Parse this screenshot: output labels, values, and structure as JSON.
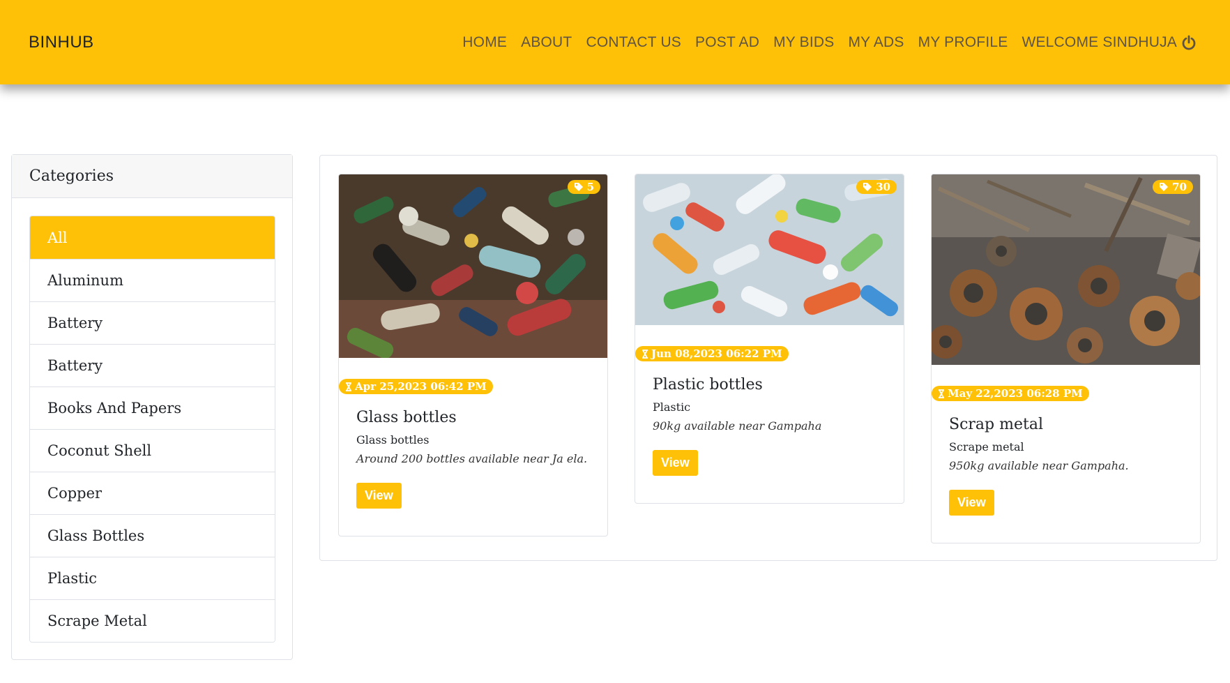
{
  "navbar": {
    "brand": "BINHUB",
    "links": [
      "HOME",
      "ABOUT",
      "CONTACT US",
      "POST AD",
      "MY BIDS",
      "MY ADS",
      "MY PROFILE"
    ],
    "welcome": "WELCOME SINDHUJA",
    "logout_icon": "power-icon"
  },
  "categories": {
    "header": "Categories",
    "items": [
      "All",
      "Aluminum",
      "Battery",
      "Battery",
      "Books And Papers",
      "Coconut Shell",
      "Copper",
      "Glass Bottles",
      "Plastic",
      "Scrape Metal"
    ],
    "active_index": 0
  },
  "listings": [
    {
      "tag_count": "5",
      "date": "Apr 25,2023 06:42 PM",
      "title": "Glass bottles",
      "category": "Glass bottles",
      "description": "Around 200 bottles available near Ja ela.",
      "button": "View",
      "image": "glass-bottles-photo"
    },
    {
      "tag_count": "30",
      "date": "Jun 08,2023 06:22 PM",
      "title": "Plastic bottles",
      "category": "Plastic",
      "description": "90kg available near Gampaha",
      "button": "View",
      "image": "plastic-bottles-photo"
    },
    {
      "tag_count": "70",
      "date": "May 22,2023 06:28 PM",
      "title": "Scrap metal",
      "category": "Scrape metal",
      "description": "950kg available near Gampaha.",
      "button": "View",
      "image": "scrap-metal-photo"
    }
  ],
  "colors": {
    "accent": "#ffc107",
    "nav_text": "#5f5441",
    "text": "#212529"
  }
}
